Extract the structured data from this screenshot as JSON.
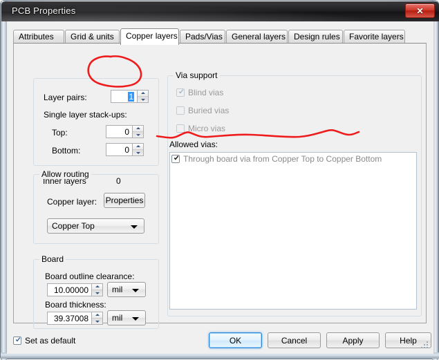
{
  "window": {
    "title": "PCB Properties",
    "close_label": "✕",
    "close_icon": "close-icon"
  },
  "tabs": [
    {
      "label": "Attributes",
      "active": false
    },
    {
      "label": "Grid & units",
      "active": false
    },
    {
      "label": "Copper layers",
      "active": true
    },
    {
      "label": "Pads/Vias",
      "active": false
    },
    {
      "label": "General layers",
      "active": false
    },
    {
      "label": "Design rules",
      "active": false
    },
    {
      "label": "Favorite layers",
      "active": false
    }
  ],
  "left": {
    "stackup": {
      "layer_pairs_label": "Layer pairs:",
      "layer_pairs_value": "1",
      "single_stackups_label": "Single layer stack-ups:",
      "top_label": "Top:",
      "top_value": "0",
      "bottom_label": "Bottom:",
      "bottom_value": "0",
      "inner_layers_label": "Inner layers",
      "inner_layers_value": "0"
    },
    "allow_routing": {
      "legend": "Allow routing",
      "copper_layer_label": "Copper layer:",
      "properties_button": "Properties",
      "layer_combo_value": "Copper Top"
    },
    "board": {
      "legend": "Board",
      "outline_clearance_label": "Board outline clearance:",
      "outline_clearance_value": "10.00000",
      "outline_clearance_unit": "mil",
      "thickness_label": "Board thickness:",
      "thickness_value": "39.37008",
      "thickness_unit": "mil"
    }
  },
  "right": {
    "via_support": {
      "legend": "Via support",
      "options": [
        {
          "label": "Blind vias",
          "checked": true,
          "disabled": true
        },
        {
          "label": "Buried vias",
          "checked": false,
          "disabled": true
        },
        {
          "label": "Micro vias",
          "checked": false,
          "disabled": true
        }
      ],
      "allowed_vias_label": "Allowed vias:",
      "allowed_vias_items": [
        {
          "label": "Through board via from Copper Top to Copper Bottom",
          "checked": true
        }
      ]
    }
  },
  "footer": {
    "set_as_default_label": "Set as default",
    "set_as_default_checked": true,
    "ok_label": "OK",
    "cancel_label": "Cancel",
    "apply_label": "Apply",
    "help_label": "Help"
  },
  "annotations": {
    "ellipse_color": "#ee1c1c",
    "squiggle_color": "#ee1c1c"
  }
}
